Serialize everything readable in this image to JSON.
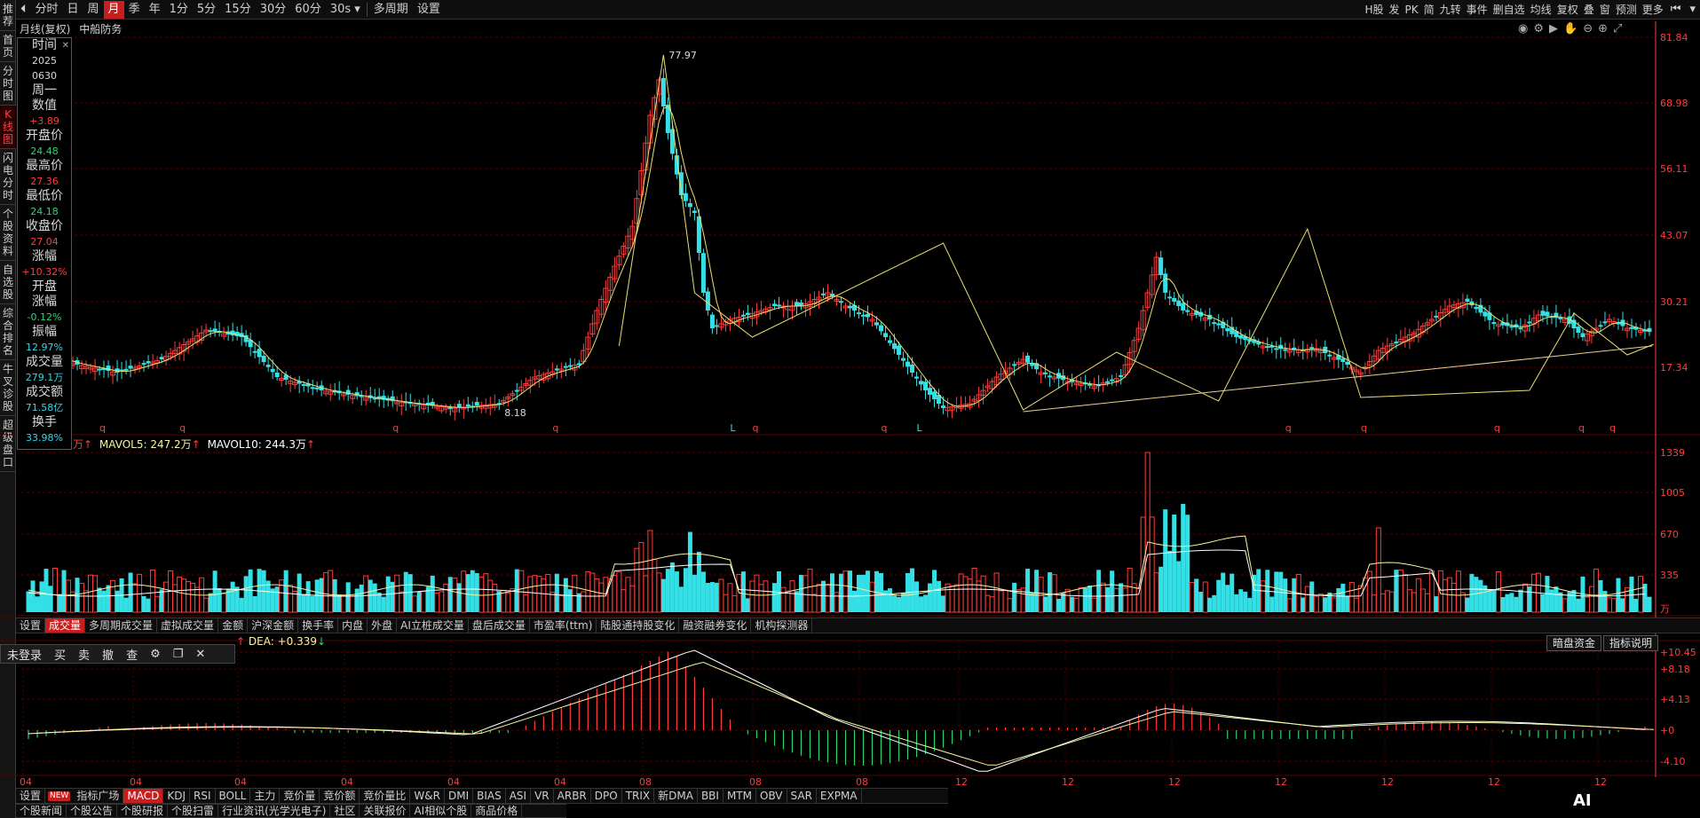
{
  "leftnav": [
    {
      "label": "推荐"
    },
    {
      "label": "首页"
    },
    {
      "label": "分时图"
    },
    {
      "label": "K线图",
      "active": true
    },
    {
      "label": "闪电分时"
    },
    {
      "label": "个股资料"
    },
    {
      "label": "自选股"
    },
    {
      "label": "综合排名"
    },
    {
      "label": "牛叉诊股"
    },
    {
      "label": "超级盘口"
    }
  ],
  "topbar": {
    "periods": [
      "分时",
      "日",
      "周",
      "月",
      "季",
      "年",
      "1分",
      "5分",
      "15分",
      "30分",
      "60分"
    ],
    "active_period": "月",
    "sec_select": "30s",
    "multi_period": "多周期",
    "settings": "设置",
    "right_items": [
      "H股",
      "发",
      "PK",
      "简",
      "九转",
      "事件",
      "删自选",
      "均线",
      "复权",
      "叠",
      "窗",
      "预测",
      "更多"
    ]
  },
  "chart_header": {
    "mode": "月线(复权)",
    "stock_name": "中船防务"
  },
  "info_panel": {
    "time_label": "时间",
    "year": "2025",
    "date": "0630",
    "weekday": "周一",
    "value_label": "数值",
    "value": "+3.89",
    "open_label": "开盘价",
    "open": "24.48",
    "high_label": "最高价",
    "high": "27.36",
    "low_label": "最低价",
    "low": "24.18",
    "close_label": "收盘价",
    "close": "27.04",
    "change_label": "涨幅",
    "change": "+10.32%",
    "open_change_label_1": "开盘",
    "open_change_label_2": "涨幅",
    "open_change": "-0.12%",
    "amplitude_label": "振幅",
    "amplitude": "12.97%",
    "volume_label": "成交量",
    "volume": "279.1万",
    "amount_label": "成交额",
    "amount": "71.58亿",
    "turnover_label": "换手",
    "turnover": "33.98%"
  },
  "price_axis": [
    "81.84",
    "68.98",
    "56.11",
    "43.07",
    "30.21",
    "17.34"
  ],
  "max_label": "77.97",
  "min_label": "8.18",
  "volume_legend": {
    "unit": "万",
    "mavol5": "MAVOL5: 247.2万",
    "mavol10": "MAVOL10: 244.3万"
  },
  "volume_axis": [
    "1339",
    "1005",
    "670",
    "335"
  ],
  "volume_unit_label": "万",
  "volume_tabs": [
    "设置",
    "成交量",
    "多周期成交量",
    "虚拟成交量",
    "金额",
    "沪深金额",
    "换手率",
    "内盘",
    "外盘",
    "AI立桩成交量",
    "盘后成交量",
    "市盈率(ttm)",
    "陆股通持股变化",
    "融资融券变化",
    "机构探测器"
  ],
  "active_volume_tab": "成交量",
  "tradebar": [
    "未登录",
    "买",
    "卖",
    "撤",
    "查",
    "⚙",
    "❐",
    "✕"
  ],
  "macd_legend": {
    "dea": "DEA: +0.339"
  },
  "macd_buttons": [
    "暗盘资金",
    "指标说明"
  ],
  "macd_axis": [
    "+10.45",
    "+8.18",
    "+4.13",
    "+0",
    "-4.10"
  ],
  "x_axis_labels": [
    "04",
    "04",
    "04",
    "04",
    "04",
    "04",
    "08",
    "08",
    "08",
    "12",
    "12",
    "12",
    "12",
    "12",
    "12",
    "12"
  ],
  "indicator_tabs": [
    "设置",
    "指标广场",
    "MACD",
    "KDJ",
    "RSI",
    "BOLL",
    "主力",
    "竞价量",
    "竞价额",
    "竞价量比",
    "W&R",
    "DMI",
    "BIAS",
    "ASI",
    "VR",
    "ARBR",
    "DPO",
    "TRIX",
    "新DMA",
    "BBI",
    "MTM",
    "OBV",
    "SAR",
    "EXPMA"
  ],
  "indicator_new_badge": "NEW",
  "active_indicator_tab": "MACD",
  "news_tabs": [
    "个股新闻",
    "个股公告",
    "个股研报",
    "个股扫雷",
    "行业资讯(光学光电子)",
    "社区",
    "关联报价",
    "AI相似个股",
    "商品价格"
  ],
  "ai_badge": "AI",
  "colors": {
    "up": "#ff3c3c",
    "down": "#33e0e6",
    "ma5": "#f5f5a0",
    "ma10": "#ffffff",
    "axis_red": "#ff3c3c",
    "active_tab": "#c81e1e"
  }
}
